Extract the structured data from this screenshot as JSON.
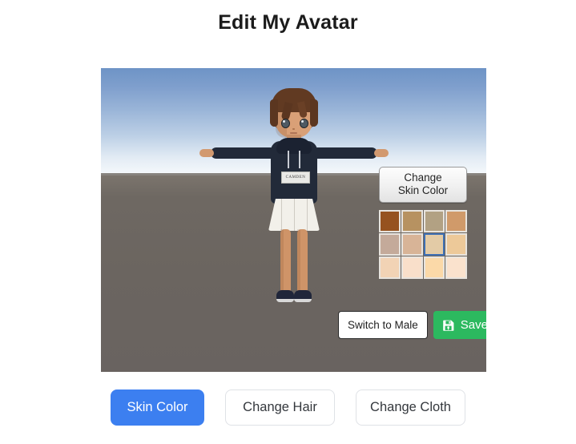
{
  "page": {
    "title": "Edit My Avatar",
    "background": "#ffffff"
  },
  "viewport": {
    "name": "avatar-3d-preview",
    "sky_top_color": "#6e94c6",
    "sky_horizon_color": "#f4f8fb",
    "ground_color": "#6b6560"
  },
  "avatar": {
    "pose": "t-pose",
    "hair_color": "#5b3620",
    "skin_color": "#d9a077",
    "hoodie_color": "#222a39",
    "skirt_color": "#f2f0ea",
    "shoe_color": "#20263a",
    "hoodie_logo_text": "CAMDEN"
  },
  "skin_panel": {
    "button_line1": "Change",
    "button_line2": "Skin Color",
    "selected_index": 6,
    "swatches": [
      {
        "name": "skin-swatch-1",
        "color": "#96521f"
      },
      {
        "name": "skin-swatch-2",
        "color": "#b79261"
      },
      {
        "name": "skin-swatch-3",
        "color": "#b2a183"
      },
      {
        "name": "skin-swatch-4",
        "color": "#d09a6a"
      },
      {
        "name": "skin-swatch-5",
        "color": "#c4aa9a"
      },
      {
        "name": "skin-swatch-6",
        "color": "#d8b497"
      },
      {
        "name": "skin-swatch-7",
        "color": "#e3cba6"
      },
      {
        "name": "skin-swatch-8",
        "color": "#edc999"
      },
      {
        "name": "skin-swatch-9",
        "color": "#f2d3b5"
      },
      {
        "name": "skin-swatch-10",
        "color": "#f9dfca"
      },
      {
        "name": "skin-swatch-11",
        "color": "#fbd9a8"
      },
      {
        "name": "skin-swatch-12",
        "color": "#fae2cd"
      }
    ],
    "selected_border_color": "#3d6fb4"
  },
  "canvas_actions": {
    "switch_label": "Switch to Male",
    "save_label": "Save",
    "save_icon": "save-floppy-icon",
    "save_color": "#2cb95f"
  },
  "bottom_tabs": [
    {
      "name": "tab-skin-color",
      "label": "Skin Color",
      "active": true
    },
    {
      "name": "tab-change-hair",
      "label": "Change Hair",
      "active": false
    },
    {
      "name": "tab-change-cloth",
      "label": "Change Cloth",
      "active": false
    }
  ],
  "colors": {
    "primary": "#3c7ff0",
    "ghost_border": "#dfe2e6",
    "title_text": "#1b1b1b"
  }
}
